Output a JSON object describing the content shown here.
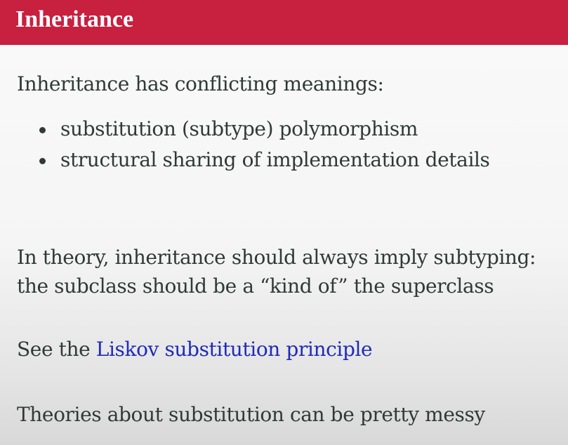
{
  "slide": {
    "title": "Inheritance",
    "intro": "Inheritance has conflicting meanings:",
    "bullets": [
      "substitution (subtype) polymorphism",
      "structural sharing of implementation details"
    ],
    "theory_line1": "In theory, inheritance should always imply subtyping:",
    "theory_line2": "the subclass should be a “kind of” the superclass",
    "see_prefix": "See the ",
    "see_link": "Liskov substitution principle",
    "closing": "Theories about substitution can be pretty messy"
  },
  "colors": {
    "title_bar": "#c8203f",
    "text": "#2f3a36",
    "link": "#1f2bb5"
  }
}
